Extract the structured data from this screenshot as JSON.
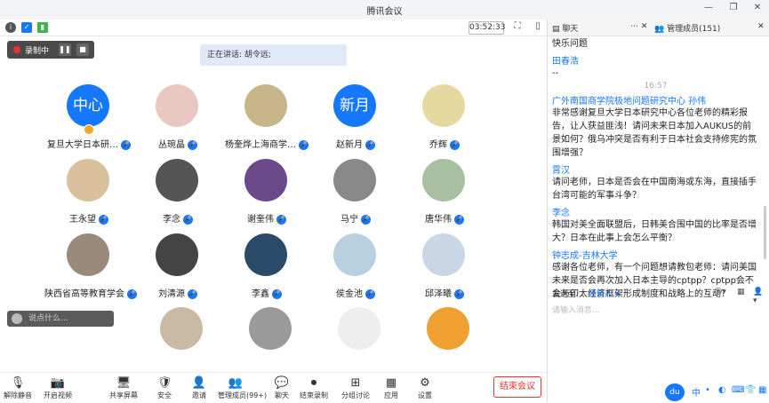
{
  "window": {
    "title": "腾讯会议"
  },
  "timer": "03:52:33",
  "recording": {
    "label": "录制中"
  },
  "speaking": "正在讲话: 胡令远;",
  "participants": [
    {
      "name": "复旦大学日本研…",
      "avatar_text": "中心",
      "host": true
    },
    {
      "name": "丛琬晶",
      "avatar_text": ""
    },
    {
      "name": "杨奎烨上海商学…",
      "avatar_text": ""
    },
    {
      "name": "赵新月",
      "avatar_text": "新月"
    },
    {
      "name": "乔辉",
      "avatar_text": ""
    },
    {
      "name": "王永望",
      "avatar_text": ""
    },
    {
      "name": "李念",
      "avatar_text": ""
    },
    {
      "name": "谢奎伟",
      "avatar_text": ""
    },
    {
      "name": "马宁",
      "avatar_text": ""
    },
    {
      "name": "唐华伟",
      "avatar_text": ""
    },
    {
      "name": "陕西省高等教育学会",
      "avatar_text": ""
    },
    {
      "name": "刘清源",
      "avatar_text": ""
    },
    {
      "name": "李鑫",
      "avatar_text": ""
    },
    {
      "name": "侯金池",
      "avatar_text": ""
    },
    {
      "name": "邱泽曦",
      "avatar_text": ""
    }
  ],
  "chat_input_overlay": "说点什么...",
  "toolbar": [
    {
      "label": "解除静音",
      "icon": "🎙"
    },
    {
      "label": "开启视频",
      "icon": "📷"
    },
    {
      "label": "共享屏幕",
      "icon": "🖥"
    },
    {
      "label": "安全",
      "icon": "🛡"
    },
    {
      "label": "邀请",
      "icon": "👤"
    },
    {
      "label": "管理成员(99+)",
      "icon": "👥"
    },
    {
      "label": "聊天",
      "icon": "💬"
    },
    {
      "label": "结束录制",
      "icon": "⏺"
    },
    {
      "label": "分组讨论",
      "icon": "⊞"
    },
    {
      "label": "应用",
      "icon": "▦"
    },
    {
      "label": "设置",
      "icon": "⚙"
    }
  ],
  "end_meeting": "结束会议",
  "side": {
    "tab_chat": "聊天",
    "tab_members": "管理成员(151)",
    "messages": [
      {
        "name": "",
        "text": "快乐问题"
      },
      {
        "name": "田春浩",
        "text": "--"
      },
      {
        "time": "16:57"
      },
      {
        "name": "广外南国商学院极地问题研究中心 孙伟",
        "text": "非常感谢复旦大学日本研究中心各位老师的精彩报告，让人获益匪浅！请问未来日本加入AUKUS的前景如何？俄乌冲突是否有利于日本社会支持修宪的氛围增强？"
      },
      {
        "name": "霄汉",
        "text": "请问老师，日本是否会在中国南海或东海，直接插手台湾可能的军事斗争？"
      },
      {
        "name": "李念",
        "text": "韩国对美全面联盟后，日韩美合围中国的比率是否增大？日本在此事上会怎么平衡？"
      },
      {
        "name": "钟志成-吉林大学",
        "text": "感谢各位老师，有一个问题想请教包老师：请问美国未来是否会再次加入日本主导的cptpp？cptpp会不会与印太经济框架形成制度和战略上的互动？"
      }
    ],
    "send_to_label": "发送至:",
    "send_to_value": "所有人 ▾",
    "input_placeholder": "请输入消息..."
  },
  "ime": {
    "logo": "du",
    "items": [
      "中",
      "•",
      "◐",
      "⌨",
      "👕",
      "▦"
    ]
  }
}
